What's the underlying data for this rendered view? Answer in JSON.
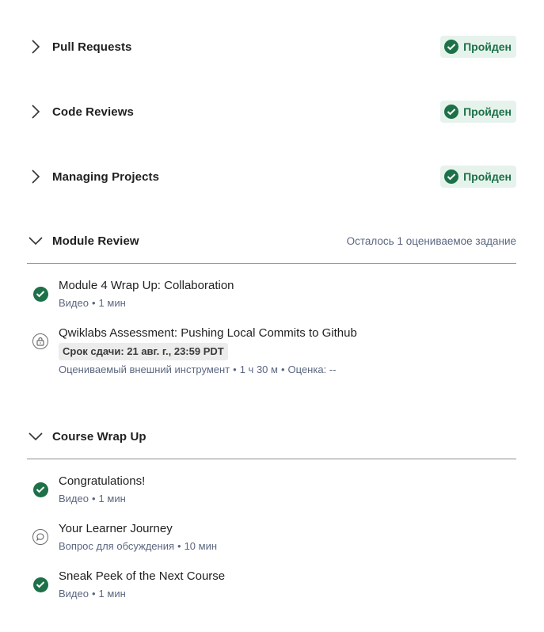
{
  "modules": [
    {
      "title": "Pull Requests",
      "status": "Пройден"
    },
    {
      "title": "Code Reviews",
      "status": "Пройден"
    },
    {
      "title": "Managing Projects",
      "status": "Пройден"
    }
  ],
  "module_review": {
    "title": "Module Review",
    "meta": "Осталось 1 оцениваемое задание",
    "items": [
      {
        "title": "Module 4 Wrap Up: Collaboration",
        "type": "Видео",
        "duration": "1 мин",
        "icon": "check-circle-icon"
      },
      {
        "title": "Qwiklabs Assessment: Pushing Local Commits to Github",
        "due": "Срок сдачи: 21 авг. г., 23:59 PDT",
        "type": "Оцениваемый внешний инструмент",
        "duration": "1 ч 30 м",
        "grade": "Оценка: --",
        "icon": "lock-icon"
      }
    ]
  },
  "course_wrap_up": {
    "title": "Course Wrap Up",
    "items": [
      {
        "title": "Congratulations!",
        "type": "Видео",
        "duration": "1 мин",
        "icon": "check-circle-icon"
      },
      {
        "title": "Your Learner Journey",
        "type": "Вопрос для обсуждения",
        "duration": "10 мин",
        "icon": "discussion-icon"
      },
      {
        "title": "Sneak Peek of the Next Course",
        "type": "Видео",
        "duration": "1 мин",
        "icon": "check-circle-icon"
      }
    ]
  },
  "colors": {
    "success": "#1d7048",
    "success_bg": "#e6f3ec",
    "meta": "#5b6780"
  }
}
